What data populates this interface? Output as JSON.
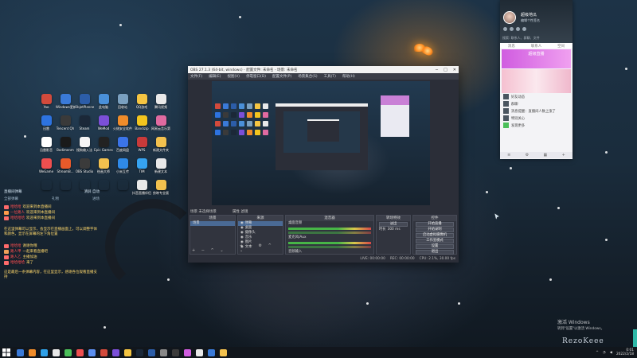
{
  "desktop": {
    "icon_rows": [
      [
        {
          "label": "Yao\nBugSucit",
          "color": "#d24a3c"
        },
        {
          "label": "Windows更新助手",
          "color": "#3a7ad8"
        },
        {
          "label": "ObjetPlanner",
          "color": "#2c5da8"
        },
        {
          "label": "此电脑",
          "color": "#4a90d9"
        },
        {
          "label": "回收站",
          "color": "#7aa0c0"
        },
        {
          "label": "QQ游戏",
          "color": "#f5c542"
        },
        {
          "label": "腾讯视频",
          "color": "#e9e9e9"
        }
      ],
      [
        {
          "label": "迅雷",
          "color": "#2d73e0"
        },
        {
          "label": "Tencent Qh\nv1.512",
          "color": "#3a3a3a"
        },
        {
          "label": "Steam",
          "color": "#1b2838"
        },
        {
          "label": "WeMod",
          "color": "#7b4fd8"
        },
        {
          "label": "火绒安全软件",
          "color": "#f08c2a"
        },
        {
          "label": "Bandizip",
          "color": "#f3c51e"
        },
        {
          "label": "网易云音乐第二版",
          "color": "#e06aa0"
        }
      ],
      [
        {
          "label": "迅雷影音",
          "color": "#ffffff"
        },
        {
          "label": "Bodimenm\nGame L...",
          "color": "#1a1a1a"
        },
        {
          "label": "搜狗输入法",
          "color": "#f5f5f5"
        },
        {
          "label": "Epic Games",
          "color": "#222"
        },
        {
          "label": "百度网盘",
          "color": "#3b74e8"
        },
        {
          "label": "WPS",
          "color": "#c93a3a"
        },
        {
          "label": "新建文件夹",
          "color": "#f2c14e"
        }
      ],
      [
        {
          "label": "WeGame",
          "color": "#ef4f4f"
        },
        {
          "label": "StreamB...",
          "color": "#e85a2a"
        },
        {
          "label": "OBS Studio",
          "color": "#3b3b3b"
        },
        {
          "label": "绘画大师",
          "color": "#f2c14e"
        },
        {
          "label": "小米互传",
          "color": "#2f8ae8"
        },
        {
          "label": "TIM",
          "color": "#36a3f0"
        },
        {
          "label": "新建文本",
          "color": "#e8e8e8"
        }
      ],
      [
        {
          "label": "",
          "color": "rgba(0,0,0,0)"
        },
        {
          "label": "",
          "color": "rgba(0,0,0,0)"
        },
        {
          "label": "",
          "color": "rgba(0,0,0,0)"
        },
        {
          "label": "",
          "color": "rgba(0,0,0,0)"
        },
        {
          "label": "",
          "color": "rgba(0,0,0,0)"
        },
        {
          "label": "抖音直播伴侣",
          "color": "#e8e8e8"
        },
        {
          "label": "剪映专业版",
          "color": "#f2c14e"
        }
      ]
    ]
  },
  "chat": {
    "header_left": "直播间弹幕",
    "header_right": "清屏 自动",
    "tabs": [
      "全部弹幕",
      "礼物",
      "进场"
    ],
    "lines": [
      {
        "who": "哈哈哈",
        "msg": "欢迎来到本直播间",
        "color": "#ff6b6b"
      },
      {
        "who": "一位路人",
        "msg": "欢迎来到本直播间",
        "color": "#ff9b4b"
      },
      {
        "who": "哈哈哈哈",
        "msg": "欢迎来到本直播间",
        "color": "#ff6b6b"
      }
    ],
    "block1": "在这里弹幕可以显示，会显示在直播画面上，可以调整字体和颜色，显示在屏幕的左下角位置",
    "lines2": [
      {
        "who": "哈哈哈",
        "msg": "谢谢你哦",
        "color": "#ff6b6b"
      },
      {
        "who": "路人甲",
        "msg": "一起来看直播吧",
        "color": "#f0a05a"
      },
      {
        "who": "路人乙",
        "msg": "主播加油",
        "color": "#ff6b6b"
      },
      {
        "who": "哈哈哈哈",
        "msg": "来了",
        "color": "#ff6b6b"
      }
    ],
    "block2": "这是最后一条弹幕内容，在这里显示，感谢各位观看直播支持"
  },
  "obs": {
    "title": "OBS 27.1.3 (64-bit, windows) - 配置文件: 未命名 - 场景: 未命名",
    "menu": [
      "文件(F)",
      "编辑(E)",
      "视图(V)",
      "停靠窗口(D)",
      "配置文件(P)",
      "场景集合(S)",
      "工具(T)",
      "帮助(H)"
    ],
    "scene_bar_left": "场景  未选择场景",
    "scene_bar_right": "属性   滤镜",
    "docks": {
      "scenes": {
        "title": "场景",
        "items": [
          "场景"
        ]
      },
      "sources": {
        "title": "来源",
        "items": [
          "弹幕",
          "桌面",
          "摄像头",
          "音乐",
          "图片",
          "文本"
        ]
      },
      "mixer": {
        "title": "混音器",
        "tracks": [
          "桌面音频",
          "麦克风/Aux",
          "音频输入"
        ]
      },
      "transitions": {
        "title": "转场特效",
        "type": "淡出",
        "duration_label": "时长",
        "duration": "300 ms"
      },
      "controls": {
        "title": "控件",
        "buttons": [
          "开始直播",
          "开始录制",
          "启动虚拟摄像机",
          "工作室模式",
          "设置",
          "退出"
        ]
      }
    },
    "status": {
      "live": "LIVE: 00:00:00",
      "rec": "REC: 00:00:00",
      "cpu": "CPU: 2.1%, 30.00 fps"
    }
  },
  "qq": {
    "name": "超级地瓜",
    "status": "编辑个性签名",
    "search_placeholder": "搜索: 联系人、群聊、文件",
    "tabs": [
      "消息",
      "联系人",
      "空间"
    ],
    "banner": "超级直播",
    "items": [
      "好友动态",
      "群聊",
      "消息提醒：直播间人数上涨了",
      "特别关心",
      "发现更多"
    ]
  },
  "watermark": {
    "line1": "激活 Windows",
    "line2": "转到\"设置\"以激活 Windows。"
  },
  "brand": "RezoKeee",
  "clock": {
    "time": "0:01",
    "date": "2022/2/18"
  }
}
